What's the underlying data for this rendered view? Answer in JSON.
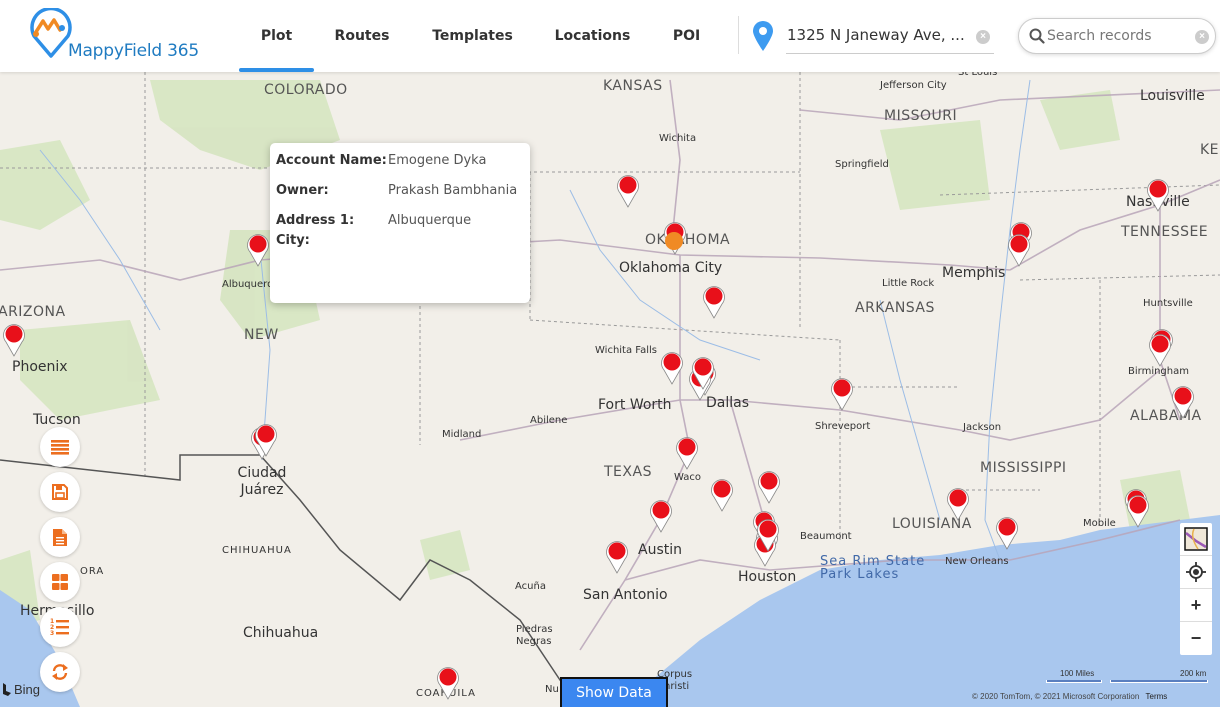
{
  "app": {
    "name": "MappyField 365",
    "brand_color": "#1f7bc1",
    "accent_color": "#2e8fe6",
    "logo_accent": "#f08a24"
  },
  "nav": {
    "tabs": [
      {
        "label": "Plot",
        "active": true
      },
      {
        "label": "Routes",
        "active": false
      },
      {
        "label": "Templates",
        "active": false
      },
      {
        "label": "Locations",
        "active": false
      },
      {
        "label": "POI",
        "active": false
      }
    ]
  },
  "location": {
    "icon": "map-pin-icon",
    "value": "1325 N Janeway Ave, ..."
  },
  "search": {
    "placeholder": "Search records",
    "value": ""
  },
  "popup": {
    "fields": [
      {
        "label": "Account Name:",
        "value": "Emogene Dyka"
      },
      {
        "label": "Owner:",
        "value": "Prakash Bambhania"
      },
      {
        "label": "Address 1: City:",
        "value": "Albuquerque"
      }
    ]
  },
  "side_tools": [
    {
      "icon": "list-icon",
      "name": "menu"
    },
    {
      "icon": "save-icon",
      "name": "save"
    },
    {
      "icon": "document-icon",
      "name": "document"
    },
    {
      "icon": "grid-icon",
      "name": "layout"
    },
    {
      "icon": "numbered-list-icon",
      "name": "ordered-list"
    },
    {
      "icon": "refresh-icon",
      "name": "refresh"
    }
  ],
  "map_controls": {
    "style_icon": "map-style-icon",
    "locate_icon": "locate-icon",
    "zoom_in": "+",
    "zoom_out": "−"
  },
  "map_labels": {
    "states": [
      "COLORADO",
      "KANSAS",
      "MISSOURI",
      "OKLAHOMA",
      "ARIZONA",
      "NEW",
      "ARKANSAS",
      "TENNESSEE",
      "TEXAS",
      "LOUISIANA",
      "MISSISSIPPI",
      "ALABAMA",
      "KEN",
      "CHIHUAHUA",
      "COAHUILA",
      "ORA"
    ],
    "cities": [
      "Oklahoma City",
      "Memphis",
      "Nashville",
      "Louisville",
      "Phoenix",
      "Tucson",
      "Fort Worth",
      "Dallas",
      "Austin",
      "San Antonio",
      "Houston",
      "Ciudad Juárez",
      "Chihuahua",
      "Hermosillo"
    ],
    "towns": [
      "St Louis",
      "Jefferson City",
      "Springfield",
      "Wichita",
      "Little Rock",
      "Huntsville",
      "Birmingham",
      "Wichita Falls",
      "Abilene",
      "Midland",
      "Shreveport",
      "Jackson",
      "Waco",
      "Beaumont",
      "New Orleans",
      "Mobile",
      "Albuquerque",
      "Acuña",
      "Piedras Negras",
      "Corpus Christi",
      "Nu"
    ],
    "water": "Sea Rim State Park Lakes"
  },
  "pins": {
    "count": 34,
    "color": "#e8101a"
  },
  "footer": {
    "show_data": "Show Data",
    "bing": "Bing",
    "scale_miles": "100 Miles",
    "scale_km": "200 km",
    "attribution": "© 2020 TomTom, © 2021 Microsoft Corporation",
    "terms": "Terms"
  }
}
